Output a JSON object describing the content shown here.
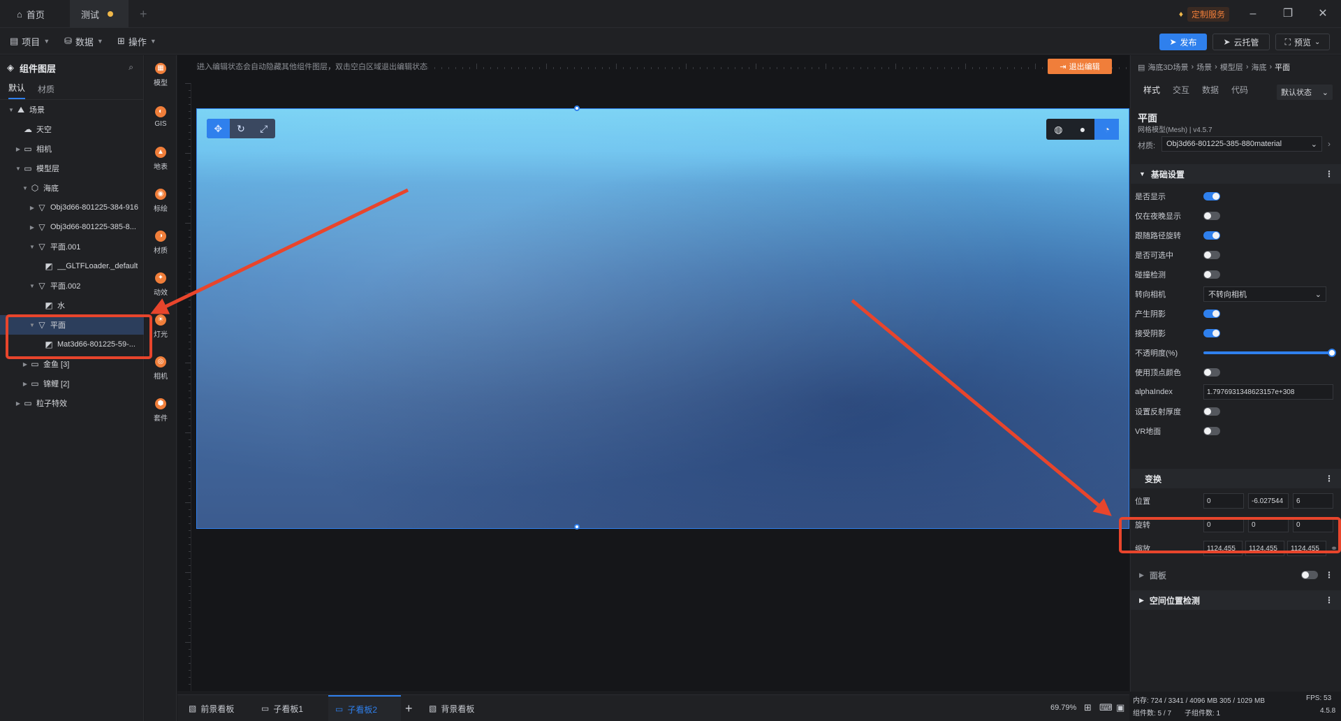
{
  "tabs": {
    "home": "首页",
    "current": "测试"
  },
  "window": {
    "custom_service": "定制服务"
  },
  "menubar": {
    "project": "项目",
    "data": "数据",
    "operation": "操作",
    "publish": "发布",
    "cloud": "云托管",
    "preview": "预览"
  },
  "layers": {
    "title": "组件图层",
    "tabs": [
      "默认",
      "材质"
    ],
    "tree": [
      {
        "label": "场景",
        "icon": "scene-icon",
        "depth": 0,
        "expanded": true
      },
      {
        "label": "天空",
        "icon": "sky-icon",
        "depth": 1
      },
      {
        "label": "相机",
        "icon": "folder-icon",
        "depth": 1,
        "collapsed": true
      },
      {
        "label": "模型层",
        "icon": "folder-icon",
        "depth": 1,
        "expanded": true
      },
      {
        "label": "海底",
        "icon": "cube-icon",
        "depth": 2,
        "expanded": true
      },
      {
        "label": "Obj3d66-801225-384-916",
        "icon": "mesh-icon",
        "depth": 3,
        "collapsed": true
      },
      {
        "label": "Obj3d66-801225-385-8...",
        "icon": "mesh-icon",
        "depth": 3,
        "collapsed": true
      },
      {
        "label": "平面.001",
        "icon": "mesh-icon",
        "depth": 3,
        "expanded": true
      },
      {
        "label": "__GLTFLoader._default",
        "icon": "material-icon",
        "depth": 4
      },
      {
        "label": "平面.002",
        "icon": "mesh-icon",
        "depth": 3,
        "expanded": true
      },
      {
        "label": "水",
        "icon": "material-icon",
        "depth": 4
      },
      {
        "label": "平面",
        "icon": "mesh-icon",
        "depth": 3,
        "expanded": true,
        "selected": true
      },
      {
        "label": "Mat3d66-801225-59-...",
        "icon": "material-icon",
        "depth": 4
      },
      {
        "label": "金鱼 [3]",
        "icon": "folder-icon",
        "depth": 2,
        "collapsed": true
      },
      {
        "label": "锦鲤 [2]",
        "icon": "folder-icon",
        "depth": 2,
        "collapsed": true
      },
      {
        "label": "粒子特效",
        "icon": "folder-icon",
        "depth": 1,
        "collapsed": true
      }
    ]
  },
  "iconbar": [
    "模型",
    "GIS",
    "地表",
    "标绘",
    "材质",
    "动效",
    "灯光",
    "相机",
    "套件"
  ],
  "canvas": {
    "hint": "进入编辑状态会自动隐藏其他组件图层，双击空白区域退出编辑状态",
    "exit_edit": "退出编辑"
  },
  "bottombar": {
    "tabs": [
      "前景看板",
      "子看板1",
      "子看板2",
      "背景看板"
    ],
    "active_tab": "子看板2",
    "zoom": "69.79%"
  },
  "props": {
    "breadcrumb": [
      "海底3D场景",
      "场景",
      "模型层",
      "海底",
      "平面"
    ],
    "tabs": [
      "样式",
      "交互",
      "数据",
      "代码"
    ],
    "state": "默认状态",
    "title": "平面",
    "subtitle": "网格模型(Mesh) | v4.5.7",
    "material_label": "材质:",
    "material_value": "Obj3d66-801225-385-880material",
    "basic_section": "基础设置",
    "rows": [
      {
        "label": "是否显示",
        "type": "toggle",
        "on": true
      },
      {
        "label": "仅在夜晚显示",
        "type": "toggle",
        "on": false
      },
      {
        "label": "跟随路径旋转",
        "type": "toggle",
        "on": true
      },
      {
        "label": "是否可选中",
        "type": "toggle",
        "on": false
      },
      {
        "label": "碰撞检测",
        "type": "toggle",
        "on": false
      },
      {
        "label": "转向相机",
        "type": "select",
        "value": "不转向相机"
      },
      {
        "label": "产生阴影",
        "type": "toggle",
        "on": true
      },
      {
        "label": "接受阴影",
        "type": "toggle",
        "on": true
      },
      {
        "label": "不透明度(%)",
        "type": "slider",
        "value": 100
      },
      {
        "label": "使用顶点颜色",
        "type": "toggle",
        "on": false
      },
      {
        "label": "alphaIndex",
        "type": "input",
        "value": "1.7976931348623157e+308"
      },
      {
        "label": "设置反射厚度",
        "type": "toggle",
        "on": false
      },
      {
        "label": "VR地面",
        "type": "toggle",
        "on": false
      }
    ],
    "transform_section": "变换",
    "position_label": "位置",
    "position": [
      "0",
      "-6.027544",
      "6"
    ],
    "rotation_label": "旋转",
    "rotation": [
      "0",
      "0",
      "0"
    ],
    "scale_label": "缩放",
    "scale": [
      "1124.455",
      "1124.455",
      "1124.455"
    ],
    "panel_section": "面板",
    "space_section": "空间位置检测"
  },
  "status": {
    "memory": "内存:  724 / 3341 / 4096 MB  305 / 1029 MB",
    "fps": "FPS:  53",
    "components": "组件数: 5 / 7",
    "sub_components": "子组件数: 1",
    "version": "4.5.8"
  },
  "colors": {
    "accent": "#2f80ed",
    "highlight": "#e8452c",
    "orange": "#f07e3a"
  }
}
